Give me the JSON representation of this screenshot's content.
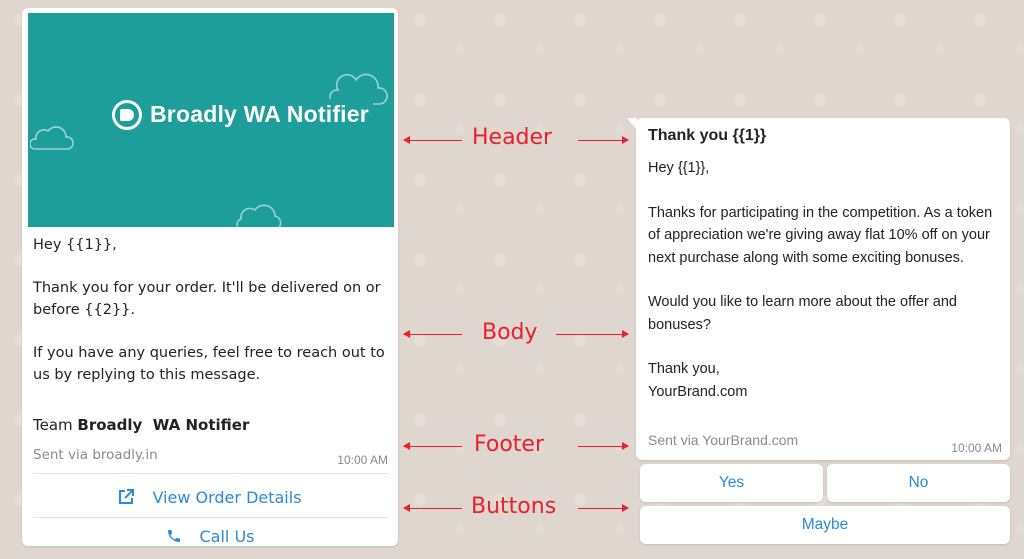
{
  "left_card": {
    "header_brand": "Broadly WA Notifier",
    "body": {
      "greeting": "Hey {{1}},",
      "line1": "Thank you for your order. It'll be delivered on or before {{2}}.",
      "line2": "If you have any queries, feel free to reach out to us by replying to this message."
    },
    "team_prefix": "Team ",
    "team_name": "Broadly  WA Notifier",
    "footer": "Sent via broadly.in",
    "time": "10:00 AM",
    "buttons": [
      {
        "label": "View Order Details",
        "icon": "external-link-icon"
      },
      {
        "label": "Call Us",
        "icon": "phone-icon"
      }
    ]
  },
  "labels": {
    "header": "Header",
    "body": "Body",
    "footer": "Footer",
    "buttons": "Buttons"
  },
  "right_card": {
    "title": "Thank you {{1}}",
    "greeting": "Hey {{1}},",
    "para1": "Thanks for participating in the competition. As a token of appreciation we're giving away flat 10% off on your next purchase along with some exciting bonuses.",
    "para2": "Would you like to learn more about the offer and bonuses?",
    "signoff1": "Thank you,",
    "signoff2": "YourBrand.com",
    "footer": "Sent via YourBrand.com",
    "time": "10:00 AM",
    "buttons": [
      "Yes",
      "No",
      "Maybe"
    ]
  },
  "colors": {
    "header_teal": "#1e9e9b",
    "accent_blue": "#2a8bd8",
    "label_red": "#e8212c"
  }
}
